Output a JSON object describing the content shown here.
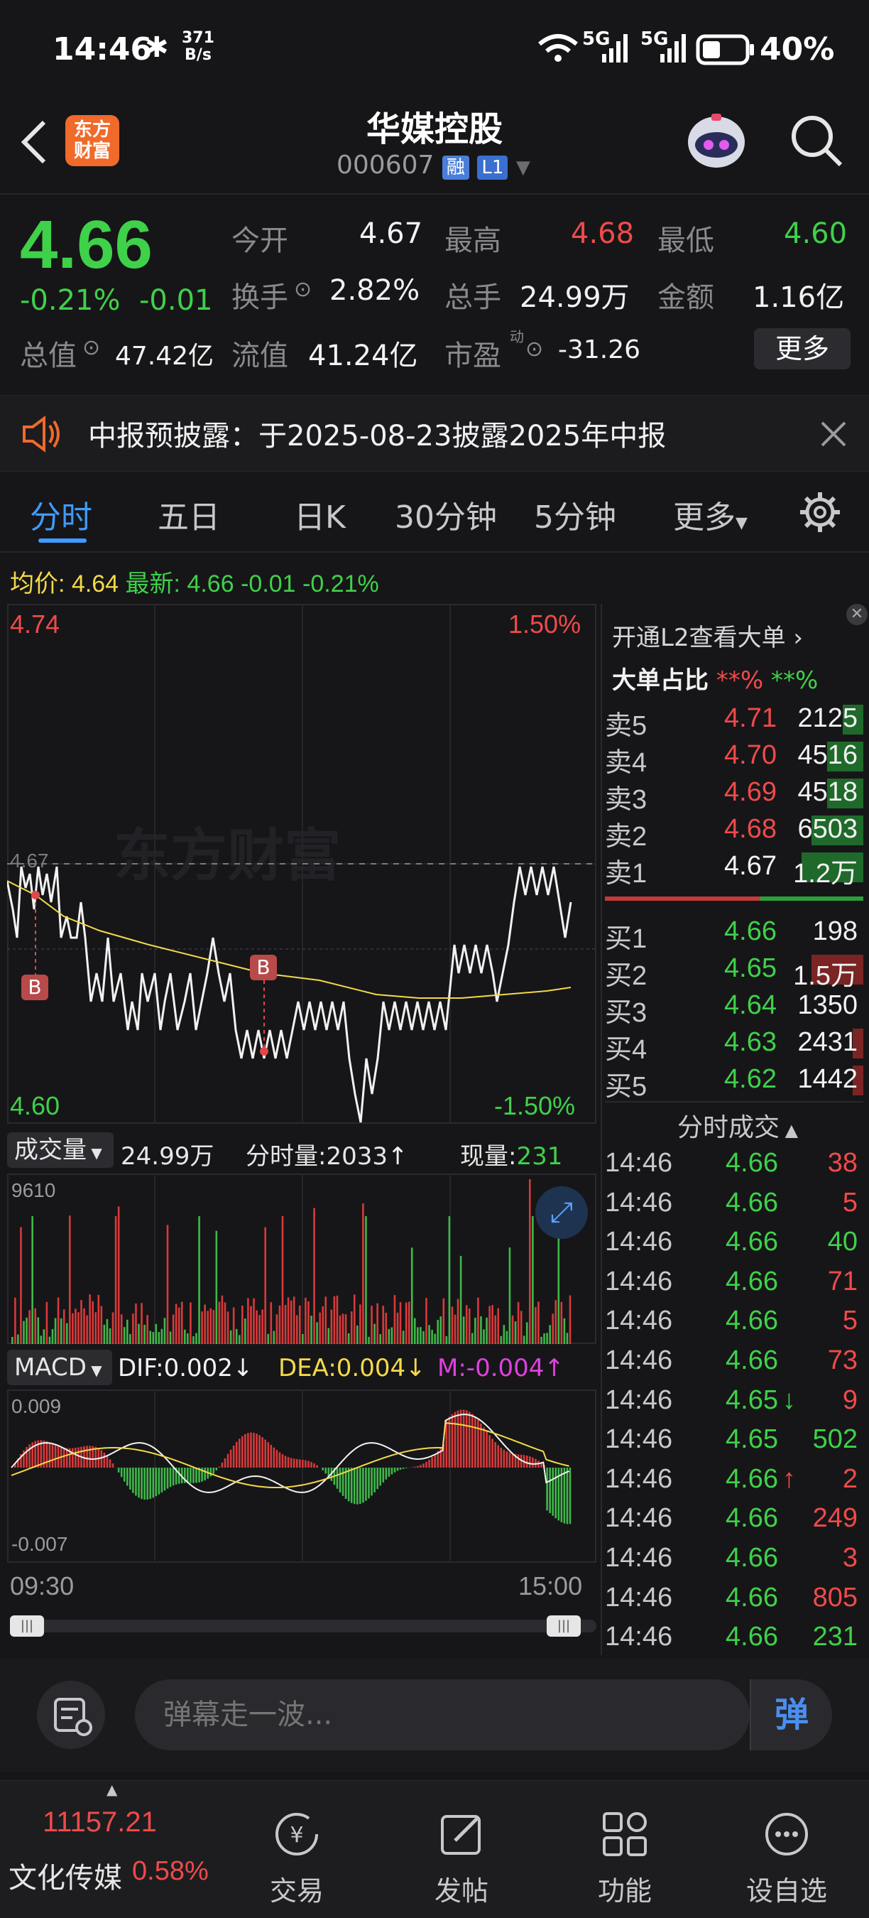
{
  "status_bar": {
    "time": "14:46",
    "speed_value": "371",
    "speed_unit": "B/s",
    "network": "5G",
    "network2": "5G",
    "battery": "40%"
  },
  "header": {
    "logo_line1": "东方",
    "logo_line2": "财富",
    "stock_name": "华媒控股",
    "stock_code": "000607",
    "tag_margin": "融",
    "tag_level": "L1"
  },
  "quote": {
    "price": "4.66",
    "change_pct": "-0.21%",
    "change_abs": "-0.01",
    "open_label": "今开",
    "open": "4.67",
    "high_label": "最高",
    "high": "4.68",
    "low_label": "最低",
    "low": "4.60",
    "turnover_label": "换手",
    "turnover": "2.82%",
    "volume_label": "总手",
    "volume": "24.99万",
    "amount_label": "金额",
    "amount": "1.16亿",
    "mktcap_label": "总值",
    "mktcap": "47.42亿",
    "float_label": "流值",
    "float": "41.24亿",
    "pe_label": "市盈",
    "pe_sup": "动",
    "pe": "-31.26",
    "more_label": "更多"
  },
  "notice": {
    "text": "中报预披露：于2025-08-23披露2025年中报"
  },
  "tabs": [
    "分时",
    "五日",
    "日K",
    "30分钟",
    "5分钟",
    "更多"
  ],
  "avg_bar": {
    "avg_label": "均价:",
    "avg": "4.64",
    "latest_label": "最新:",
    "latest": "4.66",
    "chg": "-0.01",
    "chg_pct": "-0.21%"
  },
  "intraday": {
    "y_top": "4.74",
    "y_bottom": "4.60",
    "pct_top": "1.50%",
    "pct_bottom": "-1.50%",
    "prev_close": "4.67",
    "watermark": "东方财富",
    "marker": "B"
  },
  "volume_bar": {
    "selector": "成交量",
    "total": "24.99万",
    "period_label": "分时量:",
    "period": "2033",
    "now_label": "现量:",
    "now": "231",
    "max": "9610"
  },
  "macd_bar": {
    "selector": "MACD",
    "dif_label": "DIF:",
    "dif": "0.002",
    "dea_label": "DEA:",
    "dea": "0.004",
    "m_label": "M:",
    "m": "-0.004",
    "max": "0.009",
    "min": "-0.007"
  },
  "time_axis": {
    "start": "09:30",
    "end": "15:00"
  },
  "order_book": {
    "l2_label": "开通L2查看大单",
    "big_ratio_label": "大单占比",
    "big_buy": "**%",
    "big_sell": "**%",
    "asks": [
      {
        "label": "卖5",
        "price": "4.71",
        "vol": "2125"
      },
      {
        "label": "卖4",
        "price": "4.70",
        "vol": "4516"
      },
      {
        "label": "卖3",
        "price": "4.69",
        "vol": "4518"
      },
      {
        "label": "卖2",
        "price": "4.68",
        "vol": "6503"
      },
      {
        "label": "卖1",
        "price": "4.67",
        "vol": "1.2万"
      }
    ],
    "bids": [
      {
        "label": "买1",
        "price": "4.66",
        "vol": "198"
      },
      {
        "label": "买2",
        "price": "4.65",
        "vol": "1.5万"
      },
      {
        "label": "买3",
        "price": "4.64",
        "vol": "1350"
      },
      {
        "label": "买4",
        "price": "4.63",
        "vol": "2431"
      },
      {
        "label": "买5",
        "price": "4.62",
        "vol": "1442"
      }
    ]
  },
  "trades": {
    "title": "分时成交",
    "rows": [
      {
        "time": "14:46",
        "price": "4.66",
        "vol": "38",
        "dir": ""
      },
      {
        "time": "14:46",
        "price": "4.66",
        "vol": "5",
        "dir": ""
      },
      {
        "time": "14:46",
        "price": "4.66",
        "vol": "40",
        "dir": ""
      },
      {
        "time": "14:46",
        "price": "4.66",
        "vol": "71",
        "dir": ""
      },
      {
        "time": "14:46",
        "price": "4.66",
        "vol": "5",
        "dir": ""
      },
      {
        "time": "14:46",
        "price": "4.66",
        "vol": "73",
        "dir": ""
      },
      {
        "time": "14:46",
        "price": "4.65",
        "vol": "9",
        "dir": "↓"
      },
      {
        "time": "14:46",
        "price": "4.65",
        "vol": "502",
        "dir": ""
      },
      {
        "time": "14:46",
        "price": "4.66",
        "vol": "2",
        "dir": "↑"
      },
      {
        "time": "14:46",
        "price": "4.66",
        "vol": "249",
        "dir": ""
      },
      {
        "time": "14:46",
        "price": "4.66",
        "vol": "3",
        "dir": ""
      },
      {
        "time": "14:46",
        "price": "4.66",
        "vol": "805",
        "dir": ""
      },
      {
        "time": "14:46",
        "price": "4.66",
        "vol": "231",
        "dir": ""
      }
    ]
  },
  "danmaku": {
    "placeholder": "弹幕走一波...",
    "send_label": "弹"
  },
  "bottom_nav": {
    "index_value": "11157.21",
    "index_name": "文化传媒",
    "index_pct": "0.58%",
    "items": [
      "交易",
      "发帖",
      "功能",
      "设自选"
    ]
  },
  "colors": {
    "up": "#f04a4a",
    "down": "#3fd14a",
    "accent": "#3f9bff",
    "avg_line": "#f4d94a",
    "background": "#161618"
  }
}
